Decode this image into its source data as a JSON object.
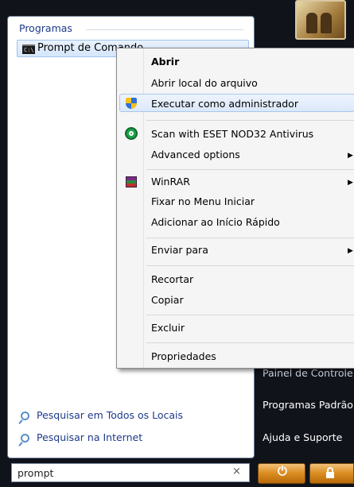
{
  "start_menu": {
    "section_title": "Programas",
    "program_item": "Prompt de Comando",
    "cmd_icon_text": "C:\\",
    "search_links": [
      "Pesquisar em Todos os Locais",
      "Pesquisar na Internet"
    ],
    "search_input": {
      "value": "prompt",
      "clear": "×"
    },
    "right_items": {
      "painel": "Painel de Controle",
      "programas_padrao": "Programas Padrão",
      "ajuda": "Ajuda e Suporte"
    },
    "power_glyph": "⏻"
  },
  "context_menu": {
    "items": [
      "Abrir",
      "Abrir local do arquivo",
      "Executar como administrador",
      "Scan with ESET NOD32 Antivirus",
      "Advanced options",
      "WinRAR",
      "Fixar no Menu Iniciar",
      "Adicionar ao Início Rápido",
      "Enviar para",
      "Recortar",
      "Copiar",
      "Excluir",
      "Propriedades"
    ],
    "submenu_arrow": "▶"
  },
  "colors": {
    "menu_highlight": "#dbe8fa",
    "link_blue": "#1e3a8a",
    "power_orange": "#d98c1f"
  },
  "icons": [
    "cmd-icon",
    "uac-shield-icon",
    "eset-icon",
    "winrar-icon",
    "search-icon",
    "power-icon",
    "lock-icon",
    "user-avatar"
  ]
}
